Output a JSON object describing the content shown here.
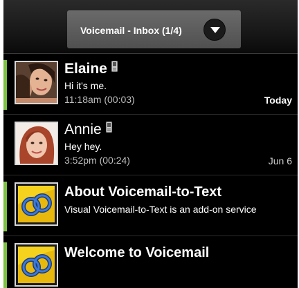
{
  "header": {
    "title": "Voicemail - Inbox (1/4)"
  },
  "messages": [
    {
      "name": "Elaine",
      "preview": "Hi it's me.",
      "meta": "11:18am (00:03)",
      "date": "Today",
      "unread": true,
      "icon": "phone-icon"
    },
    {
      "name": "Annie",
      "preview": "Hey hey.",
      "meta": "3:52pm (00:24)",
      "date": "Jun 6",
      "unread": false,
      "icon": "phone-icon"
    },
    {
      "title": "About Voicemail-to-Text",
      "preview": "Visual Voicemail-to-Text is an add-on service",
      "unread": true,
      "icon": "voicemail-logo-icon"
    },
    {
      "title": "Welcome to Voicemail",
      "unread": true,
      "icon": "voicemail-logo-icon"
    }
  ],
  "colors": {
    "unread_accent": "#7dc242",
    "background": "#000000",
    "logo_yellow": "#f5d21e",
    "logo_blue": "#2a64b0"
  }
}
